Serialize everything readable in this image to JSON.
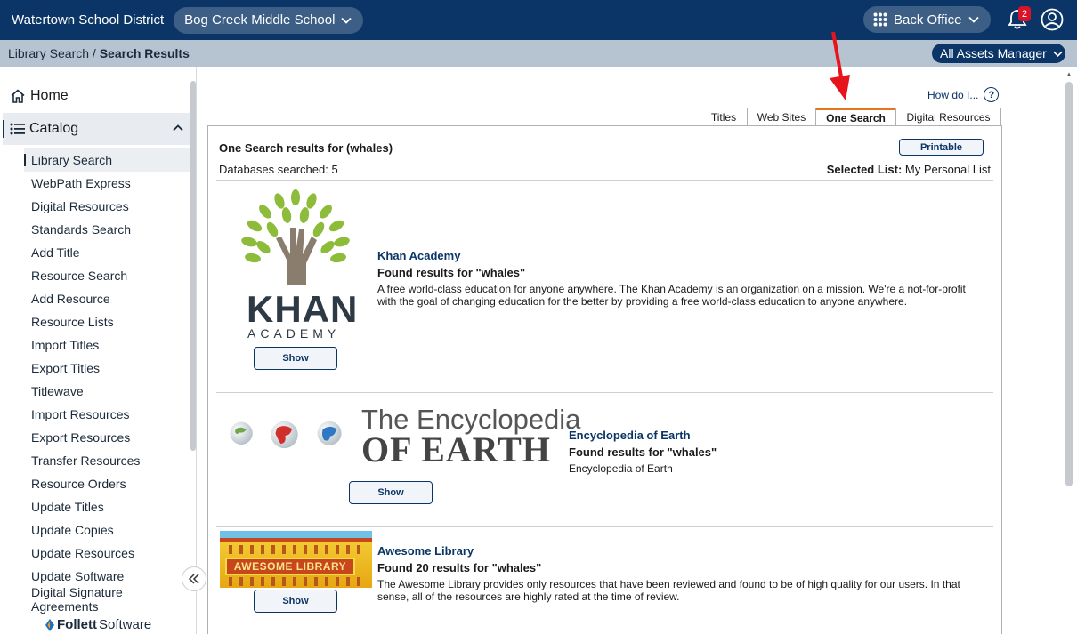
{
  "header": {
    "district": "Watertown School District",
    "school": "Bog Creek Middle School",
    "back_office": "Back Office",
    "notification_count": "2"
  },
  "breadcrumb": {
    "parent": "Library Search",
    "separator": " / ",
    "current": "Search Results"
  },
  "assets_manager": "All Assets Manager",
  "sidebar": {
    "home": "Home",
    "catalog": "Catalog",
    "items": [
      "Library Search",
      "WebPath Express",
      "Digital Resources",
      "Standards Search",
      "Add Title",
      "Resource Search",
      "Add Resource",
      "Resource Lists",
      "Import Titles",
      "Export Titles",
      "Titlewave",
      "Import Resources",
      "Export Resources",
      "Transfer Resources",
      "Resource Orders",
      "Update Titles",
      "Update Copies",
      "Update Resources",
      "Update Software",
      "Digital Signature Agreements"
    ],
    "brand_bold": "Follett",
    "brand_rest": " Software"
  },
  "help_link": "How do I...",
  "tabs": [
    "Titles",
    "Web Sites",
    "One Search",
    "Digital Resources"
  ],
  "results": {
    "title": "One Search results for (whales)",
    "printable": "Printable",
    "databases_searched": "Databases searched: 5",
    "selected_list_label": "Selected List:",
    "selected_list_value": " My Personal List",
    "show_label": "Show",
    "entries": [
      {
        "name": "Khan Academy",
        "found": "Found results for \"whales\"",
        "desc_line1": "A free world-class education for anyone anywhere. The Khan Academy is an organization on a mission. We're a not-for-profit",
        "desc_line2": "with the goal of changing education for the better by providing a free world-class education to anyone anywhere.",
        "logo_word": "KHAN",
        "logo_sub": "ACADEMY"
      },
      {
        "name": "Encyclopedia of Earth",
        "found": "Found results for \"whales\"",
        "desc_line1": "Encyclopedia of Earth",
        "logo_line1": "The Encyclopedia",
        "logo_line2": "OF EARTH"
      },
      {
        "name": "Awesome Library",
        "found": "Found 20 results for \"whales\"",
        "desc_line1": "The Awesome Library provides only resources that have been reviewed and found to be of high quality for our users. In that",
        "desc_line2": "sense, all of the resources are highly rated at the time of review.",
        "logo_banner": "AWESOME LIBRARY"
      }
    ]
  },
  "colors": {
    "header_bg": "#0a3566",
    "crumb_bg": "#b6c3d1",
    "tab_accent": "#e8741e",
    "link": "#0a3566"
  }
}
